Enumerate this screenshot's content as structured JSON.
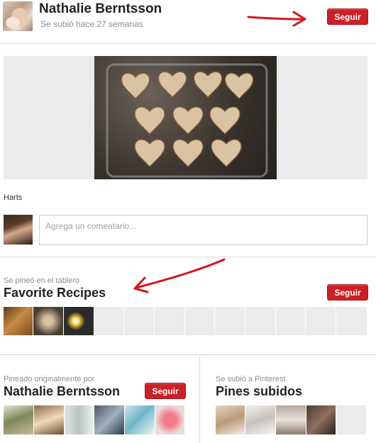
{
  "pinner": {
    "name": "Nathalie Berntsson",
    "uploaded": "Se subió hace 27 semanas",
    "follow_label": "Seguir"
  },
  "pin": {
    "description": "Harts",
    "image": "heart-shaped-cinnamon-rolls-photo"
  },
  "comment": {
    "placeholder": "Agrega un comentario..."
  },
  "board": {
    "pinned_to_label": "Se pineó en el tablero",
    "name": "Favorite Recipes",
    "follow_label": "Seguir"
  },
  "original_pinner": {
    "label": "Pineado originalmente por",
    "name": "Nathalie Berntsson",
    "follow_label": "Seguir"
  },
  "uploaded_to": {
    "label": "Se subió a Pinterest.",
    "name": "Pines subidos"
  },
  "colors": {
    "follow_red": "#cb2027",
    "annotation_arrow": "#d4161c"
  }
}
